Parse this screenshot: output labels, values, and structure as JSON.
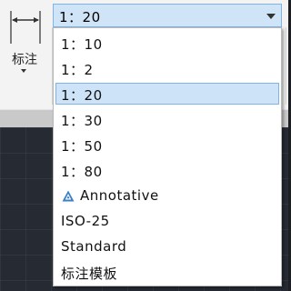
{
  "ribbon": {
    "dimension_tool_label": "标注",
    "dimension_icon": "dimension-linear-icon"
  },
  "combo": {
    "value": "1：20",
    "arrow_icon": "chevron-down-icon"
  },
  "dropdown": {
    "items": [
      {
        "label": "1：10"
      },
      {
        "label": "1：2"
      },
      {
        "label": "1：20",
        "selected": true
      },
      {
        "label": "1：30"
      },
      {
        "label": "1：50"
      },
      {
        "label": "1：80"
      },
      {
        "label": "Annotative",
        "icon": "annotative-icon"
      },
      {
        "label": "ISO-25"
      },
      {
        "label": "Standard"
      },
      {
        "label": "标注模板"
      }
    ]
  },
  "colors": {
    "selection_fill": "#cde3f7",
    "selection_border": "#7eb4ea",
    "annotative_icon": "#3b7fc4",
    "canvas_bg": "#262a33"
  }
}
